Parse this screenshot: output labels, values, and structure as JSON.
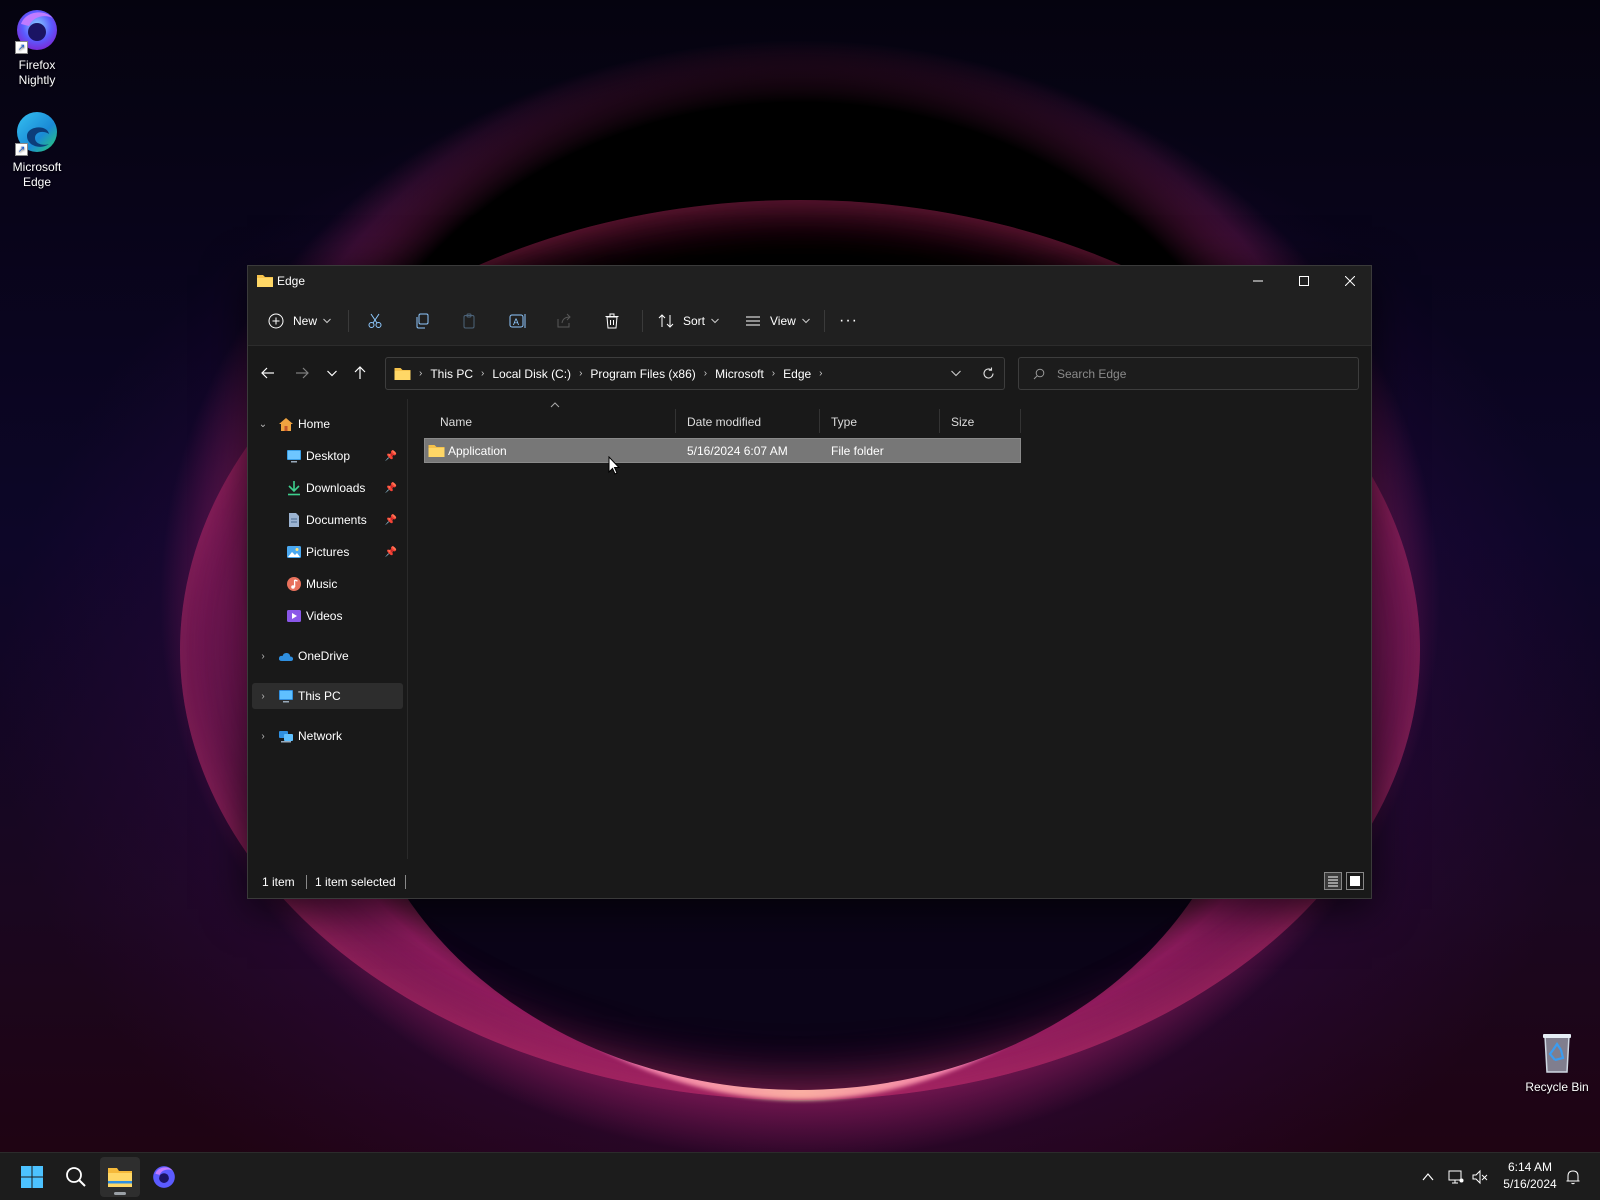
{
  "desktop": {
    "icons": [
      {
        "label_line1": "Firefox",
        "label_line2": "Nightly"
      },
      {
        "label_line1": "Microsoft",
        "label_line2": "Edge"
      },
      {
        "label_line1": "Recycle Bin",
        "label_line2": ""
      }
    ]
  },
  "window": {
    "title": "Edge",
    "toolbar": {
      "new_label": "New",
      "sort_label": "Sort",
      "view_label": "View",
      "more_label": "···"
    },
    "address": {
      "crumbs": [
        "This PC",
        "Local Disk (C:)",
        "Program Files (x86)",
        "Microsoft",
        "Edge"
      ]
    },
    "search": {
      "placeholder": "Search Edge"
    },
    "sidebar": {
      "home": "Home",
      "quick_access": [
        {
          "label": "Desktop",
          "pinned": true
        },
        {
          "label": "Downloads",
          "pinned": true
        },
        {
          "label": "Documents",
          "pinned": true
        },
        {
          "label": "Pictures",
          "pinned": true
        },
        {
          "label": "Music",
          "pinned": false
        },
        {
          "label": "Videos",
          "pinned": false
        }
      ],
      "onedrive": "OneDrive",
      "this_pc": "This PC",
      "network": "Network"
    },
    "columns": {
      "name": "Name",
      "date": "Date modified",
      "type": "Type",
      "size": "Size"
    },
    "files": [
      {
        "name": "Application",
        "date": "5/16/2024 6:07 AM",
        "type": "File folder",
        "size": ""
      }
    ],
    "status": {
      "count": "1 item",
      "selected": "1 item selected"
    }
  },
  "taskbar": {
    "time": "6:14 AM",
    "date": "5/16/2024"
  },
  "colors": {
    "folder": "#f5c24b",
    "accent": "#4cc2ff",
    "selection": "#777777"
  }
}
